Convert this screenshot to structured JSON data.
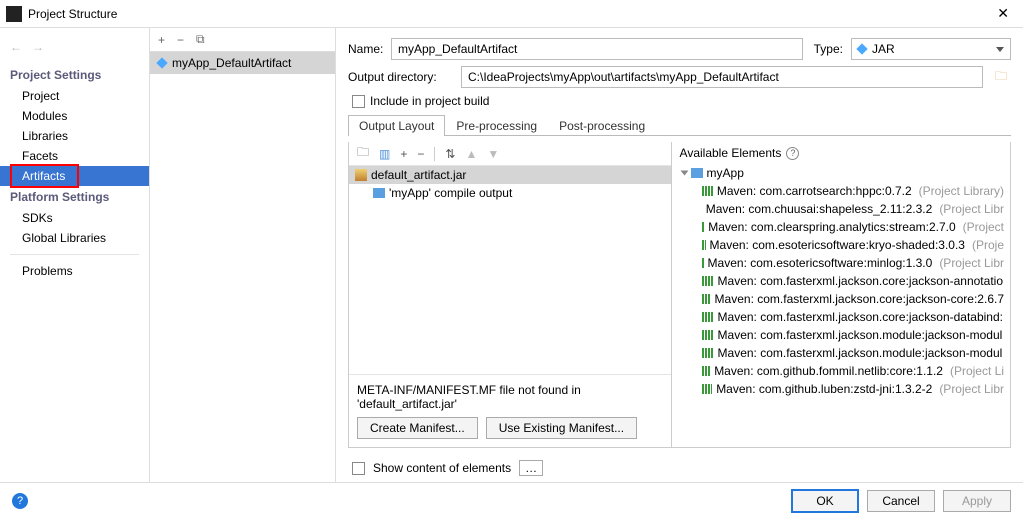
{
  "window": {
    "title": "Project Structure"
  },
  "nav": {
    "section1": "Project Settings",
    "items1": [
      "Project",
      "Modules",
      "Libraries",
      "Facets",
      "Artifacts"
    ],
    "section2": "Platform Settings",
    "items2": [
      "SDKs",
      "Global Libraries"
    ],
    "problems": "Problems"
  },
  "artifact": {
    "name": "myApp_DefaultArtifact"
  },
  "form": {
    "name_label": "Name:",
    "name_value": "myApp_DefaultArtifact",
    "type_label": "Type:",
    "type_value": "JAR",
    "outdir_label": "Output directory:",
    "outdir_value": "C:\\IdeaProjects\\myApp\\out\\artifacts\\myApp_DefaultArtifact",
    "include_label": "Include in project build"
  },
  "tabs": [
    "Output Layout",
    "Pre-processing",
    "Post-processing"
  ],
  "layout_tree": {
    "root": "default_artifact.jar",
    "child": "'myApp' compile output"
  },
  "manifest": {
    "msg": "META-INF/MANIFEST.MF file not found in 'default_artifact.jar'",
    "create": "Create Manifest...",
    "use": "Use Existing Manifest..."
  },
  "available": {
    "header": "Available Elements",
    "root": "myApp",
    "libs": [
      {
        "name": "Maven: com.carrotsearch:hppc:0.7.2",
        "suffix": "(Project Library)"
      },
      {
        "name": "Maven: com.chuusai:shapeless_2.11:2.3.2",
        "suffix": "(Project Libr"
      },
      {
        "name": "Maven: com.clearspring.analytics:stream:2.7.0",
        "suffix": "(Project"
      },
      {
        "name": "Maven: com.esotericsoftware:kryo-shaded:3.0.3",
        "suffix": "(Proje"
      },
      {
        "name": "Maven: com.esotericsoftware:minlog:1.3.0",
        "suffix": "(Project Libr"
      },
      {
        "name": "Maven: com.fasterxml.jackson.core:jackson-annotatio",
        "suffix": ""
      },
      {
        "name": "Maven: com.fasterxml.jackson.core:jackson-core:2.6.7",
        "suffix": ""
      },
      {
        "name": "Maven: com.fasterxml.jackson.core:jackson-databind:",
        "suffix": ""
      },
      {
        "name": "Maven: com.fasterxml.jackson.module:jackson-modul",
        "suffix": ""
      },
      {
        "name": "Maven: com.fasterxml.jackson.module:jackson-modul",
        "suffix": ""
      },
      {
        "name": "Maven: com.github.fommil.netlib:core:1.1.2",
        "suffix": "(Project Li"
      },
      {
        "name": "Maven: com.github.luben:zstd-jni:1.3.2-2",
        "suffix": "(Project Libr"
      }
    ]
  },
  "show_content": "Show content of elements",
  "footer": {
    "ok": "OK",
    "cancel": "Cancel",
    "apply": "Apply"
  }
}
